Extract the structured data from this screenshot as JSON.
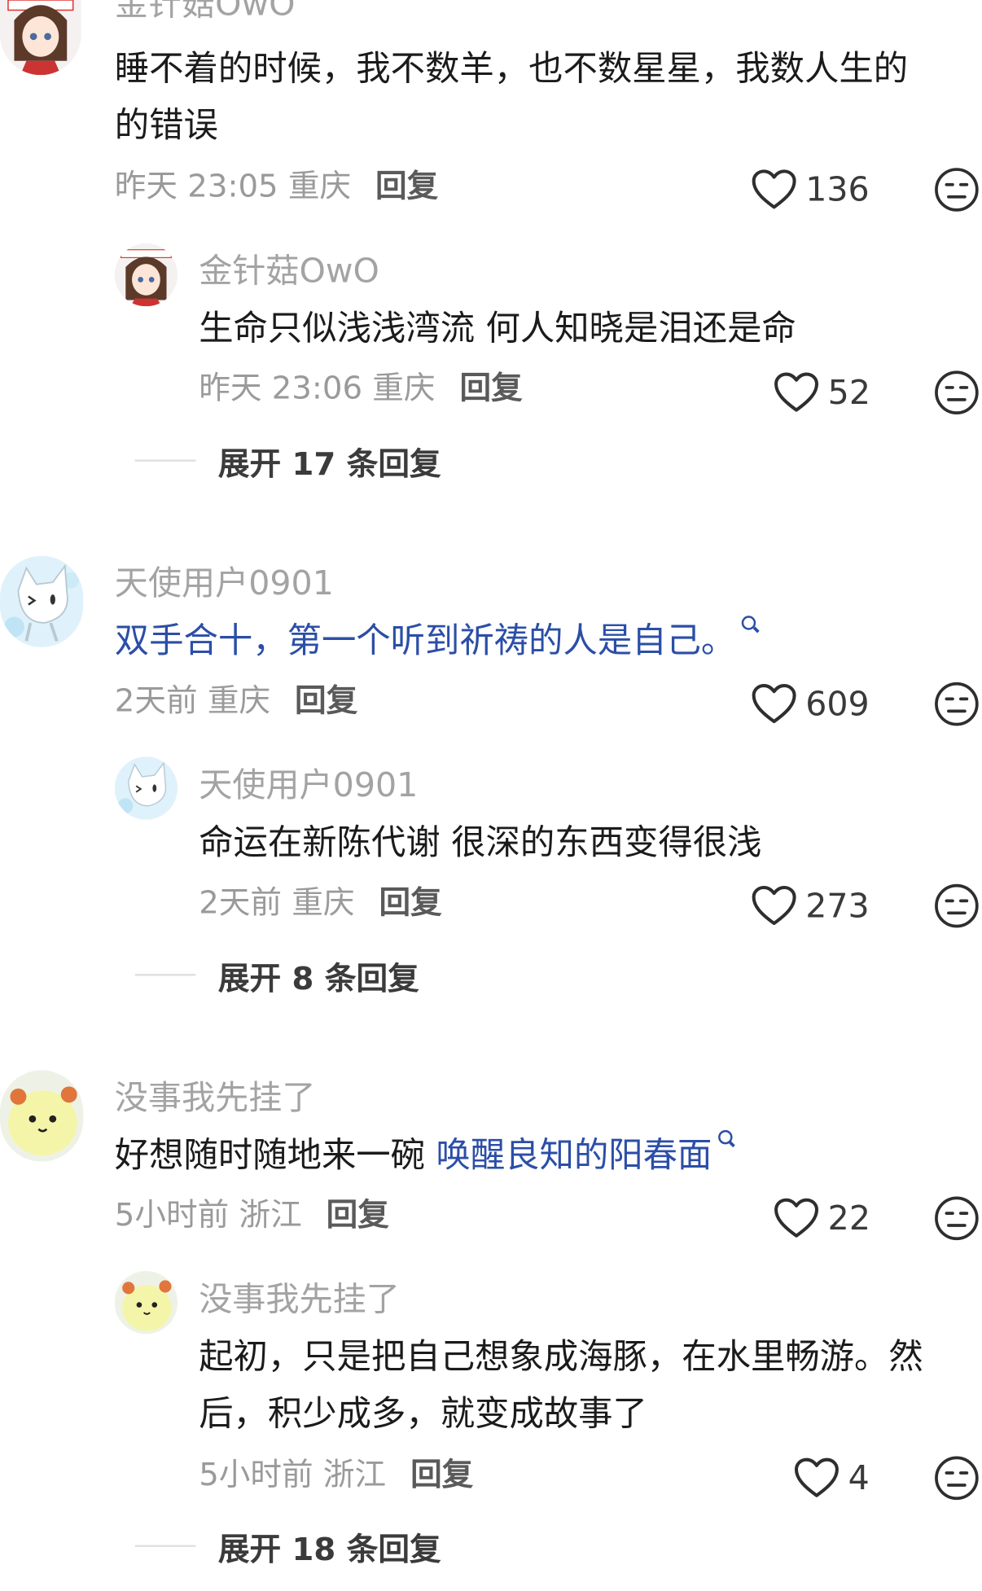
{
  "threads": [
    {
      "comment": {
        "username": "金针菇OwO",
        "text_lines": [
          "睡不着的时候，我不数羊，也不数星星，我数人生的",
          "的错误"
        ],
        "meta": "昨天 23:05 重庆",
        "reply_label": "回复",
        "likes": "136"
      },
      "reply": {
        "username": "金针菇OwO",
        "text_lines": [
          "生命只似浅浅湾流 何人知晓是泪还是命"
        ],
        "meta": "昨天 23:06 重庆",
        "reply_label": "回复",
        "likes": "52"
      },
      "expand_label": "展开 17 条回复"
    },
    {
      "comment": {
        "username": "天使用户0901",
        "text_link": "双手合十，第一个听到祈祷的人是自己。",
        "meta": "2天前 重庆",
        "reply_label": "回复",
        "likes": "609"
      },
      "reply": {
        "username": "天使用户0901",
        "text_lines": [
          "命运在新陈代谢 很深的东西变得很浅"
        ],
        "meta": "2天前 重庆",
        "reply_label": "回复",
        "likes": "273"
      },
      "expand_label": "展开 8 条回复"
    },
    {
      "comment": {
        "username": "没事我先挂了",
        "text_plain": "好想随时随地来一碗 ",
        "text_link": "唤醒良知的阳春面",
        "meta": "5小时前 浙江",
        "reply_label": "回复",
        "likes": "22"
      },
      "reply": {
        "username": "没事我先挂了",
        "text_lines": [
          "起初，只是把自己想象成海豚，在水里畅游。然",
          "后，积少成多，就变成故事了"
        ],
        "meta": "5小时前 浙江",
        "reply_label": "回复",
        "likes": "4"
      },
      "expand_label": "展开 18 条回复"
    }
  ],
  "icons": {
    "like": "heart-outline-icon",
    "dislike": "neutral-face-icon",
    "search_hint": "magnifier-icon"
  },
  "colors": {
    "link": "#2b4ea7",
    "username": "#a3a3a3",
    "meta": "#9a9a9a"
  }
}
